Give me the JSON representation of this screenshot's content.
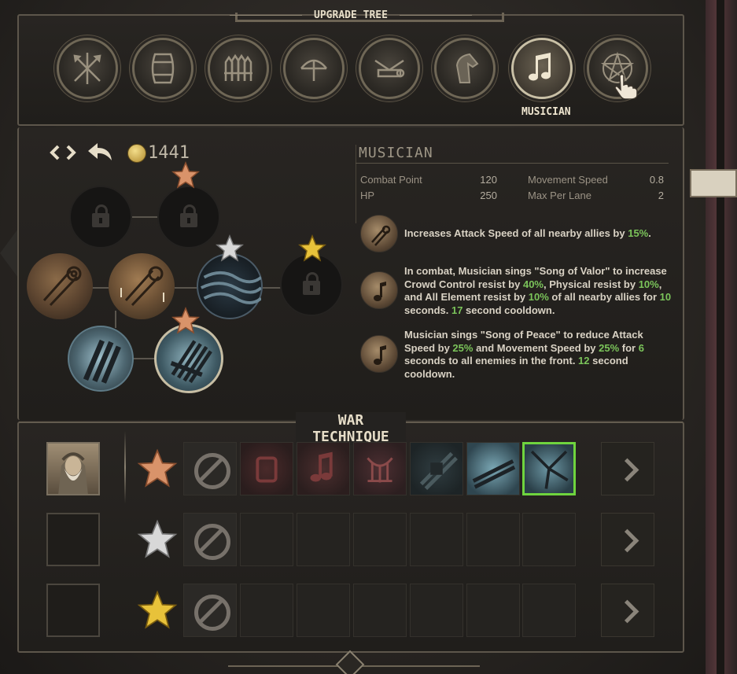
{
  "upgrade_tree": {
    "title": "UPGRADE TREE",
    "units": [
      {
        "icon": "crossed-spears-icon"
      },
      {
        "icon": "barrel-icon"
      },
      {
        "icon": "palisade-icon"
      },
      {
        "icon": "bow-icon"
      },
      {
        "icon": "ballista-icon"
      },
      {
        "icon": "horse-head-icon"
      },
      {
        "icon": "music-note-icon",
        "label": "MUSICIAN"
      },
      {
        "icon": "pentagram-icon"
      }
    ]
  },
  "controls": {
    "expand_icon": "expand-arrows-icon",
    "back_icon": "undo-arrow-icon",
    "currency_icon": "gold-coin-icon",
    "gold": "1441"
  },
  "unit_info": {
    "name": "MUSICIAN",
    "stats": [
      {
        "label": "Combat Point",
        "value": "120"
      },
      {
        "label": "HP",
        "value": "250"
      },
      {
        "label": "Movement Speed",
        "value": "0.8"
      },
      {
        "label": "Max Per Lane",
        "value": "2"
      }
    ],
    "abilities": [
      {
        "icon": "scroll-icon",
        "parts": [
          "Increases Attack Speed of all nearby allies by ",
          "15%",
          "."
        ]
      },
      {
        "icon": "music-note-icon",
        "parts": [
          "In combat, Musician sings \"Song of Valor\" to increase Crowd Control resist by ",
          "40%",
          ", Physical resist by ",
          "10%",
          ", and All Element resist by ",
          "10%",
          " of all nearby allies for ",
          "10",
          " seconds. ",
          "17",
          " second cooldown."
        ]
      },
      {
        "icon": "music-note-icon",
        "parts": [
          "Musician sings \"Song of Peace\" to reduce Attack Speed by ",
          "25%",
          " and Movement Speed by ",
          "25%",
          " for ",
          "6",
          " seconds to all enemies in the front. ",
          "12",
          " second cooldown."
        ]
      }
    ]
  },
  "war_technique": {
    "title": "WAR TECHNIQUE",
    "rows": [
      {
        "rank": "bronze",
        "hero": "bearded-elder-portrait",
        "slots": [
          "none-icon",
          "locked-scroll-icon",
          "music-note-icon",
          "harp-icon",
          "locked-pipes-icon",
          "broken-pipes-icon",
          "shattered-note-icon"
        ],
        "selected": 6
      },
      {
        "rank": "silver",
        "hero": "",
        "slots": [
          "none-icon",
          "",
          "",
          "",
          "",
          "",
          ""
        ]
      },
      {
        "rank": "gold",
        "hero": "",
        "slots": [
          "none-icon",
          "",
          "",
          "",
          "",
          "",
          ""
        ]
      }
    ]
  },
  "colors": {
    "accent_green": "#7bc45a",
    "selection_green": "#6fd43e",
    "star_bronze": "#d9936a",
    "star_silver": "#d8d8d8",
    "star_gold": "#e8c23a"
  }
}
